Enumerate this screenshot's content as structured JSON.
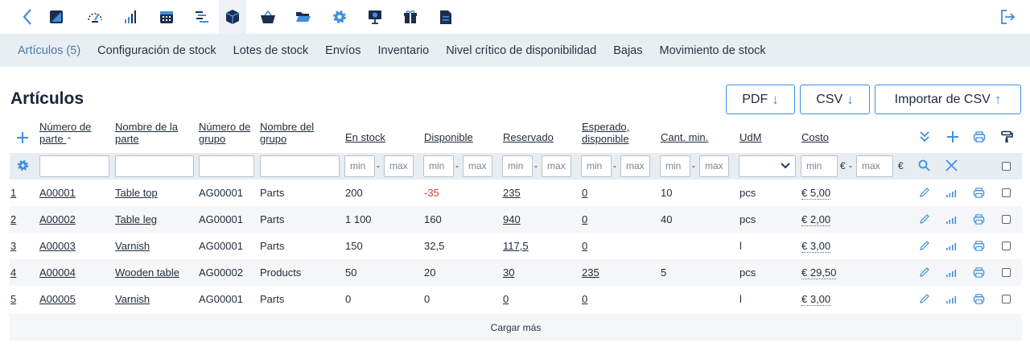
{
  "colors": {
    "accent": "#3f8fe0",
    "navy": "#1c2e4e",
    "tab_bg": "#e9eef3",
    "negative": "#e03a3a"
  },
  "topbar": {
    "icons": [
      "back-chevron-icon",
      "notes-icon",
      "dashboard-gauge-icon",
      "bar-chart-icon",
      "calendar-icon",
      "gantt-icon",
      "box-icon",
      "basket-icon",
      "folder-icon",
      "gear-icon",
      "presentation-icon",
      "gift-icon",
      "document-icon"
    ],
    "logout_icon": "logout-icon"
  },
  "tabs": [
    "Artículos (5)",
    "Configuración de stock",
    "Lotes de stock",
    "Envíos",
    "Inventario",
    "Nivel crítico de disponibilidad",
    "Bajas",
    "Movimiento de stock"
  ],
  "page": {
    "title": "Artículos"
  },
  "actions": {
    "pdf": "PDF",
    "csv": "CSV",
    "import_csv": "Importar de CSV"
  },
  "table": {
    "headers": {
      "part_no_1": "Número de",
      "part_no_2": "parte",
      "part_name_1": "Nombre de la",
      "part_name_2": "parte",
      "group_no_1": "Número de",
      "group_no_2": "grupo",
      "group_name_1": "Nombre del",
      "group_name_2": "grupo",
      "in_stock": "En stock",
      "available": "Disponible",
      "reserved": "Reservado",
      "expected_1": "Esperado,",
      "expected_2": "disponible",
      "min_qty": "Cant. min.",
      "uom": "UdM",
      "cost": "Costo"
    },
    "filters": {
      "min": "min",
      "max": "max",
      "dash": "-",
      "currency": "€"
    },
    "rows": [
      {
        "idx": "1",
        "part_no": "A00001",
        "part_name": "Table top",
        "group_no": "AG00001",
        "group_name": "Parts",
        "in_stock": "200",
        "available": "-35",
        "reserved": "235",
        "expected": "0",
        "min_qty": "10",
        "uom": "pcs",
        "cost": "€ 5,00"
      },
      {
        "idx": "2",
        "part_no": "A00002",
        "part_name": "Table leg",
        "group_no": "AG00001",
        "group_name": "Parts",
        "in_stock": "1 100",
        "available": "160",
        "reserved": "940",
        "expected": "0",
        "min_qty": "40",
        "uom": "pcs",
        "cost": "€ 2,00"
      },
      {
        "idx": "3",
        "part_no": "A00003",
        "part_name": "Varnish",
        "group_no": "AG00001",
        "group_name": "Parts",
        "in_stock": "150",
        "available": "32,5",
        "reserved": "117,5",
        "expected": "0",
        "min_qty": "",
        "uom": "l",
        "cost": "€ 3,00"
      },
      {
        "idx": "4",
        "part_no": "A00004",
        "part_name": "Wooden table",
        "group_no": "AG00002",
        "group_name": "Products",
        "in_stock": "50",
        "available": "20",
        "reserved": "30",
        "expected": "235",
        "min_qty": "5",
        "uom": "pcs",
        "cost": "€ 29,50"
      },
      {
        "idx": "5",
        "part_no": "A00005",
        "part_name": "Varnish",
        "group_no": "AG00001",
        "group_name": "Parts",
        "in_stock": "0",
        "available": "0",
        "reserved": "0",
        "expected": "0",
        "min_qty": "",
        "uom": "l",
        "cost": "€ 3,00"
      }
    ],
    "load_more": "Cargar más"
  }
}
